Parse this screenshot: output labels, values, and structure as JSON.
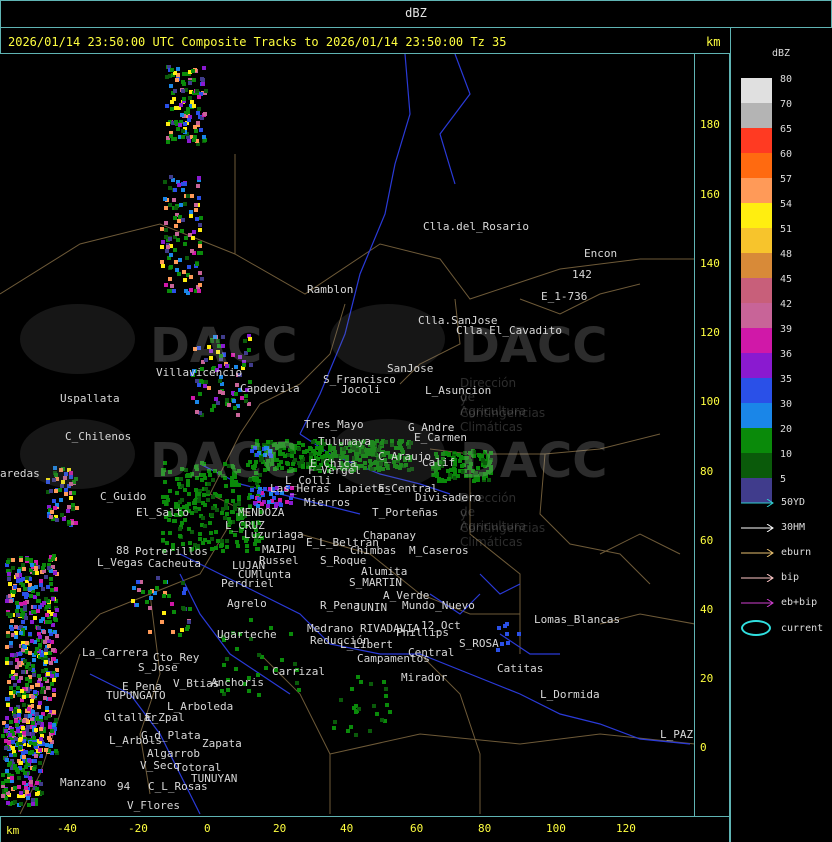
{
  "top_label": "dBZ",
  "title": "2026/01/14 23:50:00 UTC Composite Tracks to 2026/01/14 23:50:00 Tz 35",
  "km_unit": "km",
  "y_ticks": [
    "180",
    "160",
    "140",
    "120",
    "100",
    "80",
    "60",
    "40",
    "20",
    "0"
  ],
  "x_ticks": [
    "-40",
    "-20",
    "0",
    "20",
    "40",
    "60",
    "80",
    "100",
    "120"
  ],
  "legend": {
    "title": "dBZ",
    "levels": [
      {
        "label": "80",
        "color": "#e0e0e0"
      },
      {
        "label": "70",
        "color": "#b4b4b4"
      },
      {
        "label": "65",
        "color": "#ff3a22"
      },
      {
        "label": "60",
        "color": "#ff6a10"
      },
      {
        "label": "57",
        "color": "#ff9a58"
      },
      {
        "label": "54",
        "color": "#ffee10"
      },
      {
        "label": "51",
        "color": "#f7c42c"
      },
      {
        "label": "48",
        "color": "#d88a38"
      },
      {
        "label": "45",
        "color": "#c85f7a"
      },
      {
        "label": "42",
        "color": "#c86498"
      },
      {
        "label": "39",
        "color": "#d018a8"
      },
      {
        "label": "36",
        "color": "#8a1ad0"
      },
      {
        "label": "35",
        "color": "#2a50e8"
      },
      {
        "label": "30",
        "color": "#1a86e8"
      },
      {
        "label": "20",
        "color": "#0a8a0a"
      },
      {
        "label": "10",
        "color": "#0a5a0a"
      },
      {
        "label": "5",
        "color": "#403c8c"
      }
    ],
    "tracks": [
      {
        "label": "50YD",
        "color": "#30d0d0"
      },
      {
        "label": "30HM",
        "color": "#ffffff"
      },
      {
        "label": "eburn",
        "color": "#e8c070"
      },
      {
        "label": "bip",
        "color": "#ffc8c8"
      },
      {
        "label": "eb+bip",
        "color": "#d040d0"
      }
    ],
    "current_label": "current",
    "current_color": "#30e0e0"
  },
  "watermark": {
    "brand": "DACC",
    "line1": "Dirección de Agricultura",
    "line2": "y Contingencias Climáticas"
  },
  "places": [
    {
      "name": "Clla.del_Rosario"
    },
    {
      "name": "Encon"
    },
    {
      "name": "142"
    },
    {
      "name": "E_1-736"
    },
    {
      "name": "Ramblon"
    },
    {
      "name": "Clla.SanJose"
    },
    {
      "name": "Clla.El_Cavadito"
    },
    {
      "name": "Villavicencio"
    },
    {
      "name": "Capdevila"
    },
    {
      "name": "S_Francisco"
    },
    {
      "name": "Jocoli"
    },
    {
      "name": "SanJose"
    },
    {
      "name": "L_Asuncion"
    },
    {
      "name": "Uspallata"
    },
    {
      "name": "Tres_Mayo"
    },
    {
      "name": "G_Andre"
    },
    {
      "name": "C_Chilenos"
    },
    {
      "name": "Tulumaya"
    },
    {
      "name": "E_Carmen"
    },
    {
      "name": "E_Chica"
    },
    {
      "name": "C_Araujo"
    },
    {
      "name": "F_Vergel"
    },
    {
      "name": "L_Colli"
    },
    {
      "name": "Calif"
    },
    {
      "name": "aredas"
    },
    {
      "name": "Las_Heras"
    },
    {
      "name": "Lapietas"
    },
    {
      "name": "E_Central"
    },
    {
      "name": "C_Guido"
    },
    {
      "name": "Mierros"
    },
    {
      "name": "Divisadero"
    },
    {
      "name": "El_Salto"
    },
    {
      "name": "MENDOZA"
    },
    {
      "name": "T_Porteñas"
    },
    {
      "name": "L_CRUZ"
    },
    {
      "name": "Luzuriaga"
    },
    {
      "name": "Chapanay"
    },
    {
      "name": "E_L_Beltran"
    },
    {
      "name": "MAIPU"
    },
    {
      "name": "Chimbas"
    },
    {
      "name": "M_Caseros"
    },
    {
      "name": "88"
    },
    {
      "name": "Potrerillos"
    },
    {
      "name": "Russel"
    },
    {
      "name": "S_Roque"
    },
    {
      "name": "L_Vegas"
    },
    {
      "name": "Cacheuta"
    },
    {
      "name": "LUJAN"
    },
    {
      "name": "Alumita"
    },
    {
      "name": "CUMlunta"
    },
    {
      "name": "S_MARTIN"
    },
    {
      "name": "Perdriel"
    },
    {
      "name": "A_Verde"
    },
    {
      "name": "Agrelo"
    },
    {
      "name": "R_Pena"
    },
    {
      "name": "JUNIN"
    },
    {
      "name": "Mundo_Nuevo"
    },
    {
      "name": "Ugarteche"
    },
    {
      "name": "Medrano"
    },
    {
      "name": "RIVADAVIA"
    },
    {
      "name": "Phillips"
    },
    {
      "name": "12_Oct"
    },
    {
      "name": "Lomas_Blancas"
    },
    {
      "name": "Reducción"
    },
    {
      "name": "L_Libert"
    },
    {
      "name": "S_ROSA"
    },
    {
      "name": "La_Carrera"
    },
    {
      "name": "Cto_Rey"
    },
    {
      "name": "Campamentos"
    },
    {
      "name": "Central"
    },
    {
      "name": "S_Jose"
    },
    {
      "name": "Carrizal"
    },
    {
      "name": "Catitas"
    },
    {
      "name": "E_Pena"
    },
    {
      "name": "V_Btias"
    },
    {
      "name": "Anchoris"
    },
    {
      "name": "Mirador"
    },
    {
      "name": "TUPUNGATO"
    },
    {
      "name": "L_Dormida"
    },
    {
      "name": "L_Arboleda"
    },
    {
      "name": "Gltallar"
    },
    {
      "name": "E_Zpal"
    },
    {
      "name": "L_Arbols"
    },
    {
      "name": "G_d_Plata"
    },
    {
      "name": "Zapata"
    },
    {
      "name": "L_PAZ"
    },
    {
      "name": "Algarrob"
    },
    {
      "name": "V_Seco"
    },
    {
      "name": "Totoral"
    },
    {
      "name": "TUNUYAN"
    },
    {
      "name": "Manzano"
    },
    {
      "name": "94"
    },
    {
      "name": "C_L_Rosas"
    },
    {
      "name": "V_Flores"
    }
  ]
}
